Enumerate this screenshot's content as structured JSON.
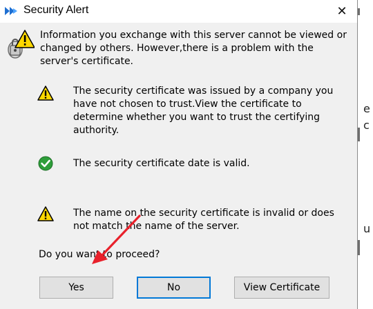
{
  "dialog": {
    "title": "Security Alert",
    "close_glyph": "✕",
    "title_icon": "shield-arrows-icon",
    "lock_icon": "padlock-warning-icon",
    "intro": "Information you exchange with this server cannot be viewed or changed by others. However,there is a problem with the server's certificate."
  },
  "checks": [
    {
      "icon": "warning-icon",
      "text": "The security certificate was issued by a company you have not chosen to trust.View the certificate to determine whether you want to trust the certifying authority."
    },
    {
      "icon": "check-icon",
      "text": "The security certificate date is valid."
    },
    {
      "icon": "warning-icon",
      "text": "The name on the security certificate is invalid or does not match the name of the server."
    }
  ],
  "question": "Do you want to proceed?",
  "buttons": {
    "yes": "Yes",
    "no": "No",
    "view_certificate": "View Certificate"
  },
  "background_fragments": [
    "e",
    "c",
    "u"
  ],
  "annotation": {
    "arrow_color": "#e8212b"
  },
  "colors": {
    "focus_border": "#0078d7",
    "warning_fill": "#ffd800",
    "check_fill": "#2e9e3a"
  }
}
